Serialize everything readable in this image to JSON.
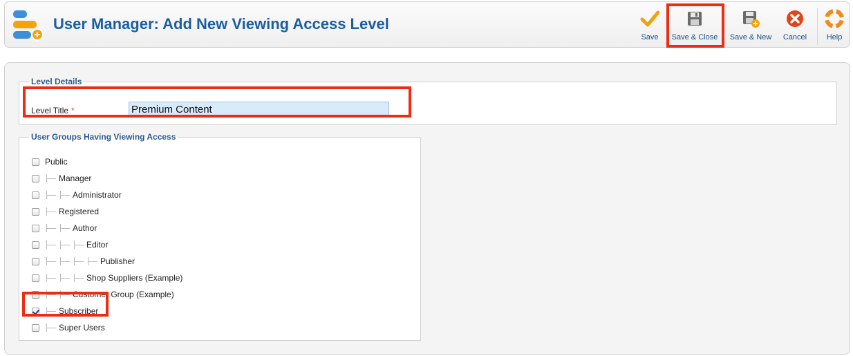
{
  "header": {
    "title": "User Manager: Add New Viewing Access Level",
    "logo_icon": "user-manager-icon"
  },
  "toolbar": {
    "buttons": [
      {
        "id": "save",
        "label": "Save",
        "icon": "checkmark-icon"
      },
      {
        "id": "save-close",
        "label": "Save & Close",
        "icon": "floppy-disk-icon"
      },
      {
        "id": "save-new",
        "label": "Save & New",
        "icon": "floppy-disk-plus-icon"
      },
      {
        "id": "cancel",
        "label": "Cancel",
        "icon": "cancel-x-icon"
      },
      {
        "id": "help",
        "label": "Help",
        "icon": "lifebuoy-icon"
      }
    ]
  },
  "level_details": {
    "legend": "Level Details",
    "title_label": "Level Title",
    "required_mark": "*",
    "title_value": "Premium Content"
  },
  "groups": {
    "legend": "User Groups Having Viewing Access",
    "items": [
      {
        "label": "Public",
        "depth": 0,
        "checked": false
      },
      {
        "label": "Manager",
        "depth": 1,
        "checked": false
      },
      {
        "label": "Administrator",
        "depth": 2,
        "checked": false
      },
      {
        "label": "Registered",
        "depth": 1,
        "checked": false
      },
      {
        "label": "Author",
        "depth": 2,
        "checked": false
      },
      {
        "label": "Editor",
        "depth": 3,
        "checked": false
      },
      {
        "label": "Publisher",
        "depth": 4,
        "checked": false
      },
      {
        "label": "Shop Suppliers (Example)",
        "depth": 3,
        "checked": false
      },
      {
        "label": "Customer Group (Example)",
        "depth": 2,
        "checked": false
      },
      {
        "label": "Subscriber",
        "depth": 1,
        "checked": true
      },
      {
        "label": "Super Users",
        "depth": 1,
        "checked": false
      }
    ]
  },
  "colors": {
    "title": "#1b5ea2",
    "legend": "#2a5a8f",
    "highlight": "#ef2c12",
    "input_bg": "#d8ebfa"
  }
}
